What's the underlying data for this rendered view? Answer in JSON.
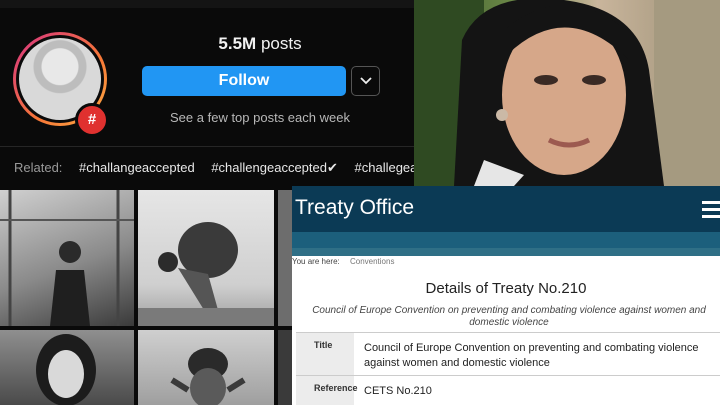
{
  "instagram": {
    "post_count": "5.5M",
    "posts_label": "posts",
    "follow_label": "Follow",
    "more_icon": "chevron-down-icon",
    "subtitle": "See a few top posts each week",
    "badge_symbol": "#",
    "related_label": "Related:",
    "related_tags": [
      "#challangeaccepted",
      "#challengeaccepted✔",
      "#challegea"
    ]
  },
  "treaty_site": {
    "title": "Treaty Office",
    "menu_icon": "hamburger-menu-icon",
    "breadcrumb_prefix": "You are here:",
    "breadcrumb_link": "Conventions",
    "heading": "Details of Treaty No.210",
    "subheading": "Council of Europe Convention on preventing and combating violence against women and domestic violence",
    "rows": [
      {
        "label": "Title",
        "value": "Council of Europe Convention on preventing and combating violence against women and domestic violence"
      },
      {
        "label": "Reference",
        "value": "CETS No.210"
      }
    ]
  }
}
